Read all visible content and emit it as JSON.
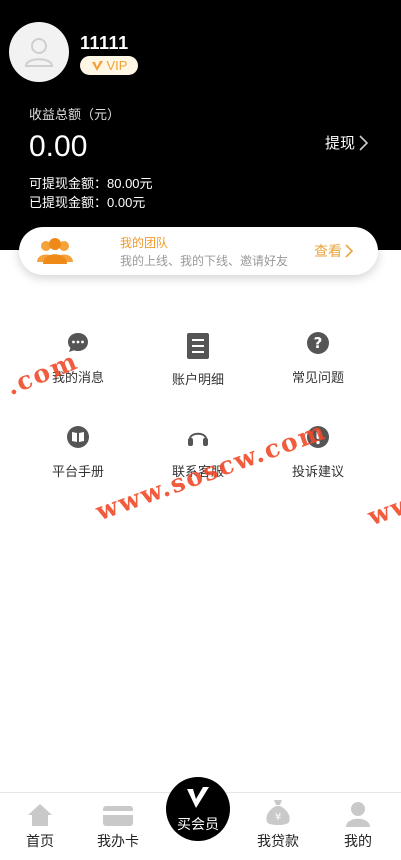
{
  "profile": {
    "username": "11111",
    "vip_label": "VIP"
  },
  "earnings": {
    "label": "收益总额（元）",
    "total": "0.00",
    "withdraw_label": "提现",
    "withdrawable": "可提现金额：80.00元",
    "withdrawn": "已提现金额：0.00元"
  },
  "team": {
    "title": "我的团队",
    "subtitle": "我的上线、我的下线、邀请好友",
    "view_label": "查看"
  },
  "menu": [
    {
      "label": "我的消息",
      "icon": "message-icon"
    },
    {
      "label": "账户明细",
      "icon": "document-icon"
    },
    {
      "label": "常见问题",
      "icon": "question-icon"
    },
    {
      "label": "平台手册",
      "icon": "book-icon"
    },
    {
      "label": "联系客服",
      "icon": "headset-icon"
    },
    {
      "label": "投诉建议",
      "icon": "alert-icon"
    }
  ],
  "watermark": {
    "part1": ".com",
    "part2": "www.soscw.com",
    "part3": "ww"
  },
  "tabbar": [
    {
      "label": "首页",
      "icon": "home-icon"
    },
    {
      "label": "我办卡",
      "icon": "card-icon"
    },
    {
      "label": "买会员",
      "icon": "vip-v-icon"
    },
    {
      "label": "我贷款",
      "icon": "money-bag-icon"
    },
    {
      "label": "我的",
      "icon": "user-icon"
    }
  ],
  "colors": {
    "header_bg": "#000000",
    "accent": "#f19a2b",
    "watermark": "#f04a2a"
  }
}
